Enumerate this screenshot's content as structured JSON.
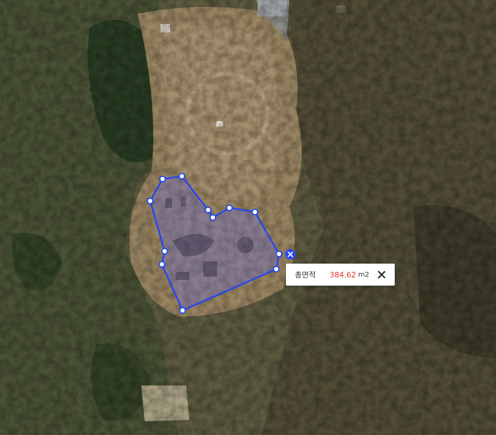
{
  "map": {
    "type": "satellite-aerial",
    "accent_color": "#2448f0"
  },
  "measure_popup": {
    "label": "총면적",
    "value": "384.62",
    "unit": "m2",
    "value_color": "#e5322d",
    "close_icon": "close-icon"
  },
  "delete_icon": "x-circle-icon"
}
